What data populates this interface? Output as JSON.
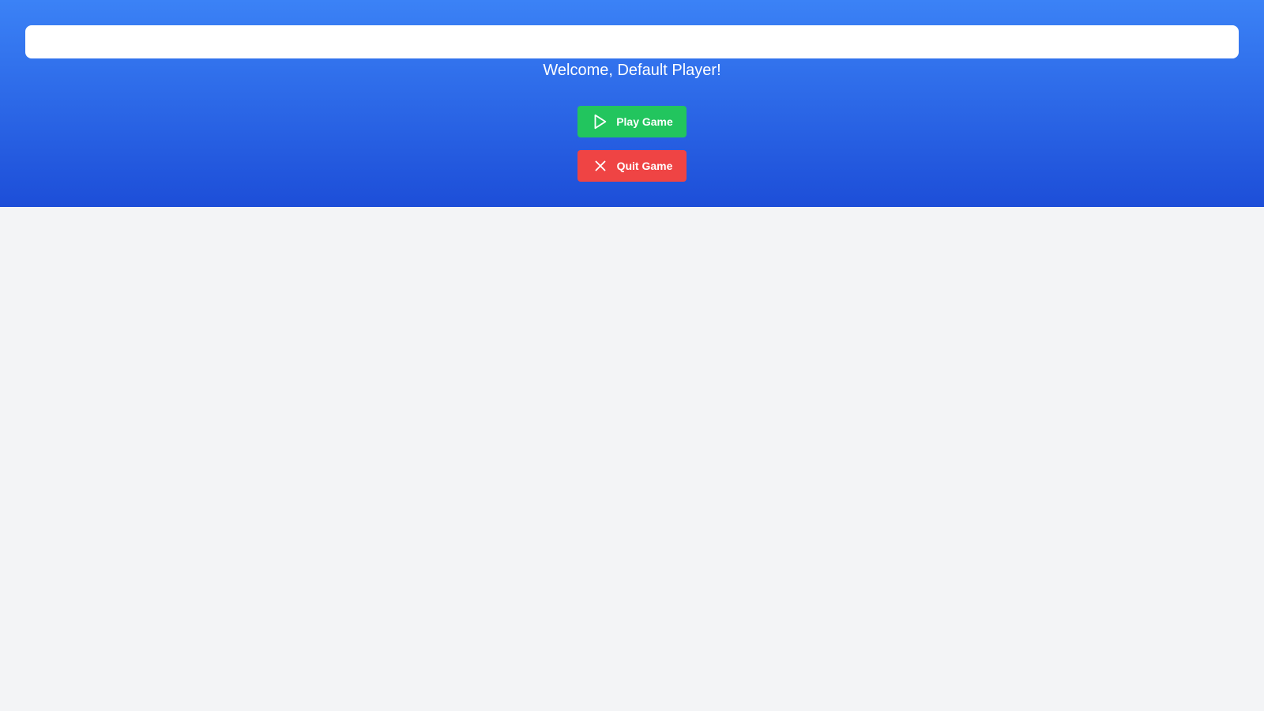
{
  "header": {
    "welcome_text": "Welcome, Default Player!"
  },
  "actions": {
    "play": {
      "label": "Play Game",
      "icon": "play-icon",
      "color": "#22c55e"
    },
    "quit": {
      "label": "Quit Game",
      "icon": "x-icon",
      "color": "#ef4444"
    }
  },
  "theme": {
    "hero_gradient_start": "#3b82f6",
    "hero_gradient_end": "#1d4ed8",
    "page_background": "#f3f4f6"
  }
}
